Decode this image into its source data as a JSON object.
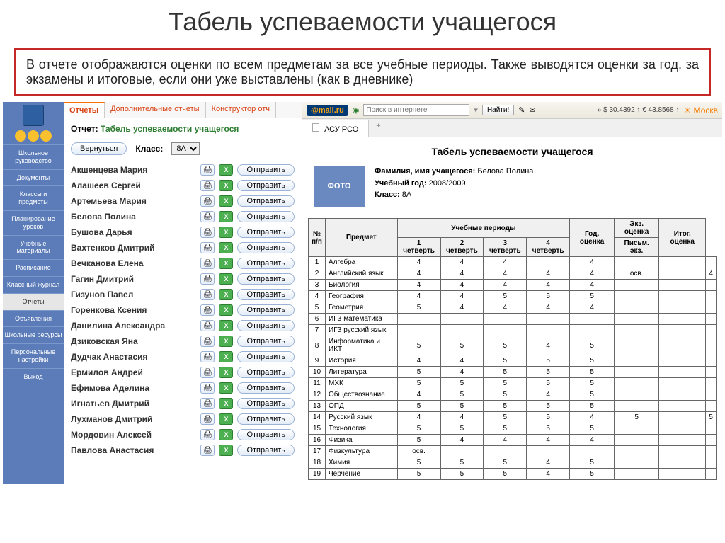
{
  "page_title": "Табель успеваемости учащегося",
  "description": "В отчете отображаются оценки по всем предметам за все учебные периоды. Также выводятся оценки за год, за экзамены и итоговые, если они уже выставлены (как в дневнике)",
  "sidebar": [
    "Школьное руководство",
    "Документы",
    "Классы и предметы",
    "Планирование уроков",
    "Учебные материалы",
    "Расписание",
    "Классный журнал",
    "Отчеты",
    "Объявления",
    "Школьные ресурсы",
    "Персональные настройки",
    "Выход"
  ],
  "active_sidebar_index": 7,
  "tabs": [
    "Отчеты",
    "Дополнительные отчеты",
    "Конструктор отч"
  ],
  "report_label": "Отчет:",
  "report_name": "Табель успеваемости учащегося",
  "back_btn": "Вернуться",
  "class_label": "Класс:",
  "class_value": "8А",
  "send_label": "Отправить",
  "students": [
    "Акшенцева Мария",
    "Алашеев Сергей",
    "Артемьева Мария",
    "Белова Полина",
    "Бушова Дарья",
    "Вахтенков Дмитрий",
    "Вечканова Елена",
    "Гагин Дмитрий",
    "Гизунов Павел",
    "Горенкова Ксения",
    "Данилина Александра",
    "Дзиковская Яна",
    "Дудчак Анастасия",
    "Ермилов Андрей",
    "Ефимова Аделина",
    "Игнатьев Дмитрий",
    "Лухманов Дмитрий",
    "Мордовин Алексей",
    "Павлова Анастасия"
  ],
  "mailru": {
    "logo": "@mail.ru",
    "search_placeholder": "Поиск в интернете",
    "find": "Найти!",
    "currency": "» $ 30.4392 ↑ € 43.8568 ↑",
    "weather": "☀ Москв"
  },
  "browser_tab": "АСУ РСО",
  "report_title_right": "Табель успеваемости учащегося",
  "photo_label": "ФОТО",
  "meta": {
    "name_label": "Фамилия, имя учащегося:",
    "name_value": "Белова Полина",
    "year_label": "Учебный год:",
    "year_value": "2008/2009",
    "class_label": "Класс:",
    "class_value": "8А"
  },
  "table": {
    "h_num": "№ п/п",
    "h_subj": "Предмет",
    "h_periods": "Учебные периоды",
    "h_q": [
      "1 четверть",
      "2 четверть",
      "3 четверть",
      "4 четверть"
    ],
    "h_year": "Год. оценка",
    "h_exam": "Экз. оценка",
    "h_exam_sub": "Письм. экз.",
    "h_final": "Итог. оценка",
    "rows": [
      {
        "n": 1,
        "s": "Алгебра",
        "g": [
          "4",
          "4",
          "4",
          "",
          "4",
          "",
          "",
          ""
        ]
      },
      {
        "n": 2,
        "s": "Английский язык",
        "g": [
          "4",
          "4",
          "4",
          "4",
          "4",
          "осв.",
          "",
          "4"
        ]
      },
      {
        "n": 3,
        "s": "Биология",
        "g": [
          "4",
          "4",
          "4",
          "4",
          "4",
          "",
          "",
          ""
        ]
      },
      {
        "n": 4,
        "s": "География",
        "g": [
          "4",
          "4",
          "5",
          "5",
          "5",
          "",
          "",
          ""
        ]
      },
      {
        "n": 5,
        "s": "Геометрия",
        "g": [
          "5",
          "4",
          "4",
          "4",
          "4",
          "",
          "",
          ""
        ]
      },
      {
        "n": 6,
        "s": "ИГЗ математика",
        "g": [
          "",
          "",
          "",
          "",
          "",
          "",
          "",
          ""
        ]
      },
      {
        "n": 7,
        "s": "ИГЗ русский язык",
        "g": [
          "",
          "",
          "",
          "",
          "",
          "",
          "",
          ""
        ]
      },
      {
        "n": 8,
        "s": "Информатика и ИКТ",
        "g": [
          "5",
          "5",
          "5",
          "4",
          "5",
          "",
          "",
          ""
        ]
      },
      {
        "n": 9,
        "s": "История",
        "g": [
          "4",
          "4",
          "5",
          "5",
          "5",
          "",
          "",
          ""
        ]
      },
      {
        "n": 10,
        "s": "Литература",
        "g": [
          "5",
          "4",
          "5",
          "5",
          "5",
          "",
          "",
          ""
        ]
      },
      {
        "n": 11,
        "s": "МХК",
        "g": [
          "5",
          "5",
          "5",
          "5",
          "5",
          "",
          "",
          ""
        ]
      },
      {
        "n": 12,
        "s": "Обществознание",
        "g": [
          "4",
          "5",
          "5",
          "4",
          "5",
          "",
          "",
          ""
        ]
      },
      {
        "n": 13,
        "s": "ОПД",
        "g": [
          "5",
          "5",
          "5",
          "5",
          "5",
          "",
          "",
          ""
        ]
      },
      {
        "n": 14,
        "s": "Русский язык",
        "g": [
          "4",
          "4",
          "5",
          "5",
          "4",
          "5",
          "",
          "5"
        ]
      },
      {
        "n": 15,
        "s": "Технология",
        "g": [
          "5",
          "5",
          "5",
          "5",
          "5",
          "",
          "",
          ""
        ]
      },
      {
        "n": 16,
        "s": "Физика",
        "g": [
          "5",
          "4",
          "4",
          "4",
          "4",
          "",
          "",
          ""
        ]
      },
      {
        "n": 17,
        "s": "Физкультура",
        "g": [
          "осв.",
          "",
          "",
          "",
          "",
          "",
          "",
          ""
        ]
      },
      {
        "n": 18,
        "s": "Химия",
        "g": [
          "5",
          "5",
          "5",
          "4",
          "5",
          "",
          "",
          ""
        ]
      },
      {
        "n": 19,
        "s": "Черчение",
        "g": [
          "5",
          "5",
          "5",
          "4",
          "5",
          "",
          "",
          ""
        ]
      }
    ]
  }
}
